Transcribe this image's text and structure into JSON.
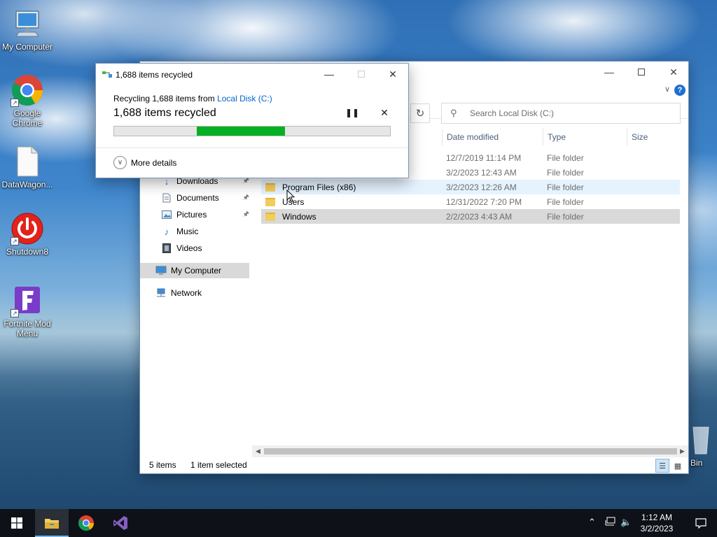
{
  "desktop": {
    "icons": [
      {
        "label": "My Computer"
      },
      {
        "label": "Google Chrome"
      },
      {
        "label": "DataWagon..."
      },
      {
        "label": "Shutdown8"
      },
      {
        "label": "Fortnite Mod Menu"
      },
      {
        "label": "e Bin"
      }
    ]
  },
  "explorer": {
    "search_placeholder": "Search Local Disk (C:)",
    "columns": {
      "date_modified": "Date modified",
      "type": "Type",
      "size": "Size"
    },
    "nav": {
      "downloads": "Downloads",
      "documents": "Documents",
      "pictures": "Pictures",
      "music": "Music",
      "videos": "Videos",
      "my_computer": "My Computer",
      "network": "Network"
    },
    "rows": [
      {
        "name": "",
        "date": "12/7/2019 11:14 PM",
        "type": "File folder"
      },
      {
        "name": "",
        "date": "3/2/2023 12:43 AM",
        "type": "File folder"
      },
      {
        "name": "Program Files (x86)",
        "date": "3/2/2023 12:26 AM",
        "type": "File folder"
      },
      {
        "name": "Users",
        "date": "12/31/2022 7:20 PM",
        "type": "File folder"
      },
      {
        "name": "Windows",
        "date": "2/2/2023 4:43 AM",
        "type": "File folder"
      }
    ],
    "status": {
      "items": "5 items",
      "selected": "1 item selected"
    }
  },
  "dialog": {
    "title": "1,688 items recycled",
    "subtitle_prefix": "Recycling 1,688 items from ",
    "subtitle_link": "Local Disk (C:)",
    "main": "1,688 items recycled",
    "more_details": "More details",
    "progress_start": 0.3,
    "progress_end": 0.62
  },
  "taskbar": {
    "time": "1:12 AM",
    "date": "3/2/2023"
  },
  "colors": {
    "accent": "#0066cc",
    "progress_green": "#06b025",
    "taskbar": "#0e1117"
  }
}
